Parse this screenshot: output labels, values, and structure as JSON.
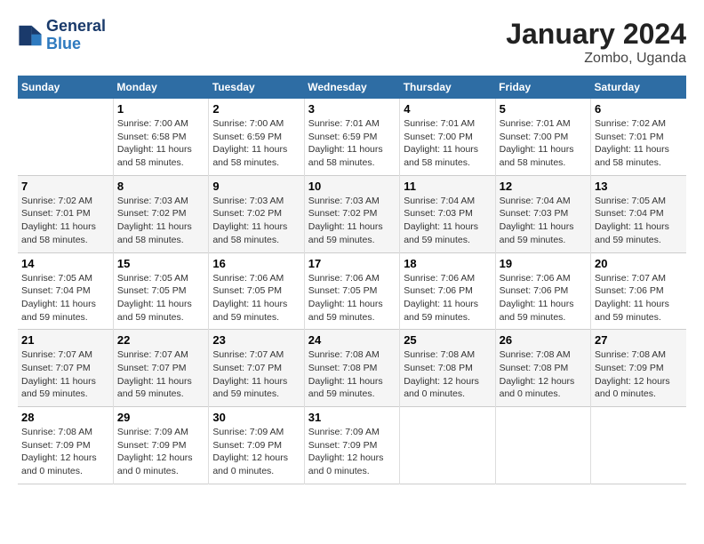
{
  "header": {
    "logo_line1": "General",
    "logo_line2": "Blue",
    "title": "January 2024",
    "subtitle": "Zombo, Uganda"
  },
  "weekdays": [
    "Sunday",
    "Monday",
    "Tuesday",
    "Wednesday",
    "Thursday",
    "Friday",
    "Saturday"
  ],
  "weeks": [
    [
      {
        "day": "",
        "info": ""
      },
      {
        "day": "1",
        "info": "Sunrise: 7:00 AM\nSunset: 6:58 PM\nDaylight: 11 hours and 58 minutes."
      },
      {
        "day": "2",
        "info": "Sunrise: 7:00 AM\nSunset: 6:59 PM\nDaylight: 11 hours and 58 minutes."
      },
      {
        "day": "3",
        "info": "Sunrise: 7:01 AM\nSunset: 6:59 PM\nDaylight: 11 hours and 58 minutes."
      },
      {
        "day": "4",
        "info": "Sunrise: 7:01 AM\nSunset: 7:00 PM\nDaylight: 11 hours and 58 minutes."
      },
      {
        "day": "5",
        "info": "Sunrise: 7:01 AM\nSunset: 7:00 PM\nDaylight: 11 hours and 58 minutes."
      },
      {
        "day": "6",
        "info": "Sunrise: 7:02 AM\nSunset: 7:01 PM\nDaylight: 11 hours and 58 minutes."
      }
    ],
    [
      {
        "day": "7",
        "info": "Sunrise: 7:02 AM\nSunset: 7:01 PM\nDaylight: 11 hours and 58 minutes."
      },
      {
        "day": "8",
        "info": "Sunrise: 7:03 AM\nSunset: 7:02 PM\nDaylight: 11 hours and 58 minutes."
      },
      {
        "day": "9",
        "info": "Sunrise: 7:03 AM\nSunset: 7:02 PM\nDaylight: 11 hours and 58 minutes."
      },
      {
        "day": "10",
        "info": "Sunrise: 7:03 AM\nSunset: 7:02 PM\nDaylight: 11 hours and 59 minutes."
      },
      {
        "day": "11",
        "info": "Sunrise: 7:04 AM\nSunset: 7:03 PM\nDaylight: 11 hours and 59 minutes."
      },
      {
        "day": "12",
        "info": "Sunrise: 7:04 AM\nSunset: 7:03 PM\nDaylight: 11 hours and 59 minutes."
      },
      {
        "day": "13",
        "info": "Sunrise: 7:05 AM\nSunset: 7:04 PM\nDaylight: 11 hours and 59 minutes."
      }
    ],
    [
      {
        "day": "14",
        "info": "Sunrise: 7:05 AM\nSunset: 7:04 PM\nDaylight: 11 hours and 59 minutes."
      },
      {
        "day": "15",
        "info": "Sunrise: 7:05 AM\nSunset: 7:05 PM\nDaylight: 11 hours and 59 minutes."
      },
      {
        "day": "16",
        "info": "Sunrise: 7:06 AM\nSunset: 7:05 PM\nDaylight: 11 hours and 59 minutes."
      },
      {
        "day": "17",
        "info": "Sunrise: 7:06 AM\nSunset: 7:05 PM\nDaylight: 11 hours and 59 minutes."
      },
      {
        "day": "18",
        "info": "Sunrise: 7:06 AM\nSunset: 7:06 PM\nDaylight: 11 hours and 59 minutes."
      },
      {
        "day": "19",
        "info": "Sunrise: 7:06 AM\nSunset: 7:06 PM\nDaylight: 11 hours and 59 minutes."
      },
      {
        "day": "20",
        "info": "Sunrise: 7:07 AM\nSunset: 7:06 PM\nDaylight: 11 hours and 59 minutes."
      }
    ],
    [
      {
        "day": "21",
        "info": "Sunrise: 7:07 AM\nSunset: 7:07 PM\nDaylight: 11 hours and 59 minutes."
      },
      {
        "day": "22",
        "info": "Sunrise: 7:07 AM\nSunset: 7:07 PM\nDaylight: 11 hours and 59 minutes."
      },
      {
        "day": "23",
        "info": "Sunrise: 7:07 AM\nSunset: 7:07 PM\nDaylight: 11 hours and 59 minutes."
      },
      {
        "day": "24",
        "info": "Sunrise: 7:08 AM\nSunset: 7:08 PM\nDaylight: 11 hours and 59 minutes."
      },
      {
        "day": "25",
        "info": "Sunrise: 7:08 AM\nSunset: 7:08 PM\nDaylight: 12 hours and 0 minutes."
      },
      {
        "day": "26",
        "info": "Sunrise: 7:08 AM\nSunset: 7:08 PM\nDaylight: 12 hours and 0 minutes."
      },
      {
        "day": "27",
        "info": "Sunrise: 7:08 AM\nSunset: 7:09 PM\nDaylight: 12 hours and 0 minutes."
      }
    ],
    [
      {
        "day": "28",
        "info": "Sunrise: 7:08 AM\nSunset: 7:09 PM\nDaylight: 12 hours and 0 minutes."
      },
      {
        "day": "29",
        "info": "Sunrise: 7:09 AM\nSunset: 7:09 PM\nDaylight: 12 hours and 0 minutes."
      },
      {
        "day": "30",
        "info": "Sunrise: 7:09 AM\nSunset: 7:09 PM\nDaylight: 12 hours and 0 minutes."
      },
      {
        "day": "31",
        "info": "Sunrise: 7:09 AM\nSunset: 7:09 PM\nDaylight: 12 hours and 0 minutes."
      },
      {
        "day": "",
        "info": ""
      },
      {
        "day": "",
        "info": ""
      },
      {
        "day": "",
        "info": ""
      }
    ]
  ]
}
